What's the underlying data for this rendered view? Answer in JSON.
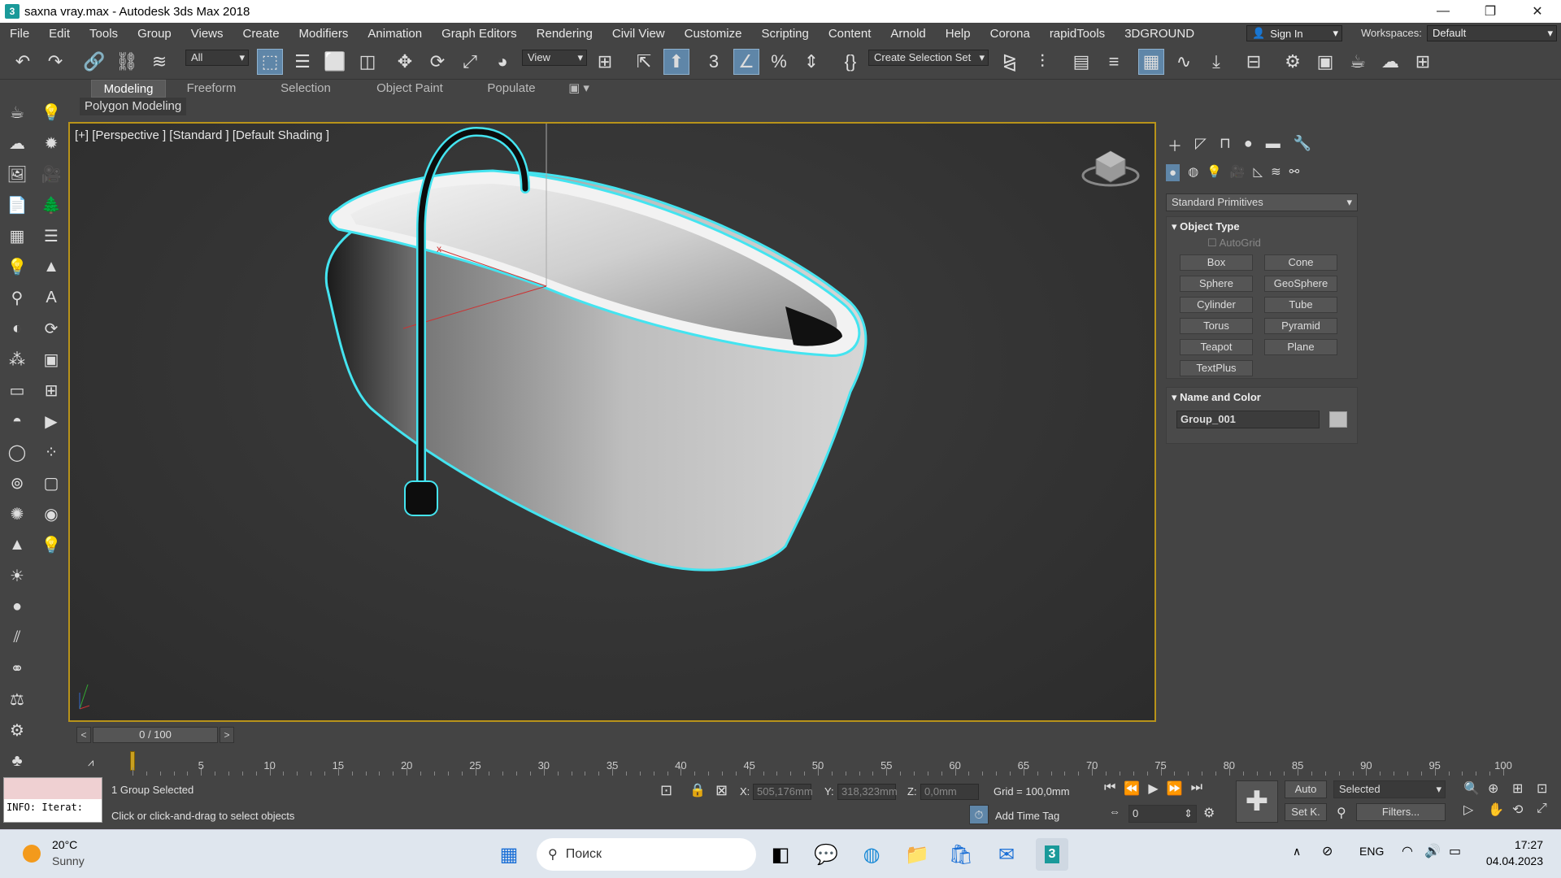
{
  "window": {
    "title": "saxna vray.max - Autodesk 3ds Max 2018",
    "app_icon": "3",
    "minimize": "—",
    "restore": "❐",
    "close": "✕"
  },
  "menu": [
    "File",
    "Edit",
    "Tools",
    "Group",
    "Views",
    "Create",
    "Modifiers",
    "Animation",
    "Graph Editors",
    "Rendering",
    "Civil View",
    "Customize",
    "Scripting",
    "Content",
    "Arnold",
    "Help",
    "Corona",
    "rapidTools",
    "3DGROUND"
  ],
  "account": {
    "signin": "Sign In",
    "workspaces_label": "Workspaces:",
    "workspace_value": "Default"
  },
  "toolbar": {
    "selection_filter": "All",
    "ref_coord": "View",
    "selection_set": "Create Selection Set"
  },
  "ribbon": {
    "tabs": [
      "Modeling",
      "Freeform",
      "Selection",
      "Object Paint",
      "Populate"
    ],
    "active": "Modeling",
    "sub": "Polygon Modeling"
  },
  "viewport": {
    "label": "[+] [Perspective ] [Standard ] [Default Shading ]",
    "selection_color": "#44e4f0"
  },
  "command_panel": {
    "category": "Standard Primitives",
    "object_type_title": "Object Type",
    "autogrid": "AutoGrid",
    "buttons": [
      "Box",
      "Cone",
      "Sphere",
      "GeoSphere",
      "Cylinder",
      "Tube",
      "Torus",
      "Pyramid",
      "Teapot",
      "Plane",
      "TextPlus"
    ],
    "name_color_title": "Name and Color",
    "object_name": "Group_001"
  },
  "timeline": {
    "frame": "0 / 100",
    "prev": "<",
    "next": ">",
    "ticks": [
      "5",
      "10",
      "15",
      "20",
      "25",
      "30",
      "35",
      "40",
      "45",
      "50",
      "55",
      "60",
      "65",
      "70",
      "75",
      "80",
      "85",
      "90",
      "95",
      "100"
    ]
  },
  "status": {
    "listener": "INFO: Iterat:",
    "selected": "1 Group Selected",
    "prompt": "Click or click-and-drag to select objects",
    "x_label": "X:",
    "x_value": "505,176mm",
    "y_label": "Y:",
    "y_value": "318,323mm",
    "z_label": "Z:",
    "z_value": "0,0mm",
    "grid": "Grid = 100,0mm",
    "add_time_tag": "Add Time Tag",
    "auto": "Auto",
    "setk": "Set K.",
    "key_filter": "Selected",
    "filters": "Filters...",
    "frame_field": "0"
  },
  "taskbar": {
    "temp": "20°C",
    "weather": "Sunny",
    "search": "Поиск",
    "lang": "ENG",
    "time": "17:27",
    "date": "04.04.2023"
  }
}
